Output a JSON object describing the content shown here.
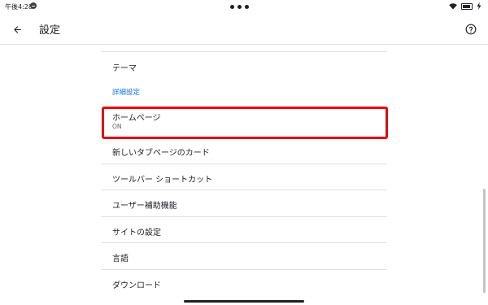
{
  "status_bar": {
    "time": "午後4:28"
  },
  "app_bar": {
    "title": "設定",
    "back_icon": "arrow-back-icon",
    "help_icon": "help-circle-icon"
  },
  "settings": {
    "theme": "テーマ",
    "advanced_header": "詳細設定",
    "homepage": {
      "label": "ホームページ",
      "value": "ON"
    },
    "items": [
      "新しいタブページのカード",
      "ツールバー ショートカット",
      "ユーザー補助機能",
      "サイトの設定",
      "言語",
      "ダウンロード"
    ]
  },
  "colors": {
    "accent": "#1a73e8",
    "highlight": "#e8000b"
  }
}
